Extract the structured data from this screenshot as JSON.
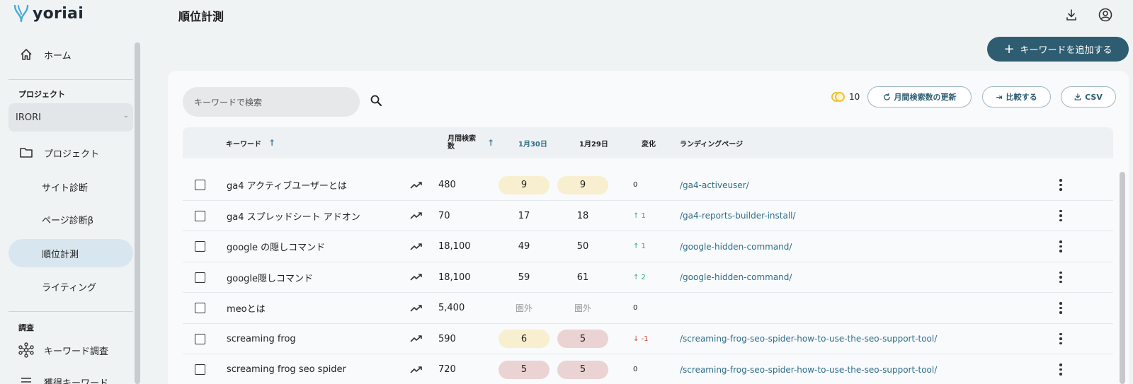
{
  "app": {
    "name": "yoriai"
  },
  "page": {
    "title": "順位計測"
  },
  "sidebar": {
    "home": "ホーム",
    "project_section": "プロジェクト",
    "project_selected": "IRORI",
    "project_item": "プロジェクト",
    "site_diagnosis": "サイト診断",
    "page_diagnosis": "ページ診断β",
    "rank_tracking": "順位計測",
    "writing": "ライティング",
    "research_section": "調査",
    "keyword_research": "キーワード調査",
    "acquired_keywords": "獲得キーワード"
  },
  "toolbar": {
    "add_keyword": "キーワードを追加する",
    "search_placeholder": "キーワードで検索",
    "credits": "10",
    "update_volume": "月間検索数の更新",
    "compare": "比較する",
    "csv": "CSV"
  },
  "table": {
    "headers": {
      "keyword": "キーワード",
      "volume": "月間検索数",
      "date1": "1月30日",
      "date2": "1月29日",
      "change": "変化",
      "landing": "ランディングページ"
    },
    "rows": [
      {
        "keyword": "ga4 アクティブユーザーとは",
        "volume": "480",
        "r1": "9",
        "r2": "9",
        "change": "0",
        "landing": "/ga4-activeuser/"
      },
      {
        "keyword": "ga4 スプレッドシート アドオン",
        "volume": "70",
        "r1": "17",
        "r2": "18",
        "change": "↑ 1",
        "landing": "/ga4-reports-builder-install/"
      },
      {
        "keyword": "google の隠しコマンド",
        "volume": "18,100",
        "r1": "49",
        "r2": "50",
        "change": "↑ 1",
        "landing": "/google-hidden-command/"
      },
      {
        "keyword": "google隠しコマンド",
        "volume": "18,100",
        "r1": "59",
        "r2": "61",
        "change": "↑ 2",
        "landing": "/google-hidden-command/"
      },
      {
        "keyword": "meoとは",
        "volume": "5,400",
        "r1": "圏外",
        "r2": "圏外",
        "change": "0",
        "landing": ""
      },
      {
        "keyword": "screaming frog",
        "volume": "590",
        "r1": "6",
        "r2": "5",
        "change": "↓ -1",
        "landing": "/screaming-frog-seo-spider-how-to-use-the-seo-support-tool/"
      },
      {
        "keyword": "screaming frog seo spider",
        "volume": "720",
        "r1": "5",
        "r2": "5",
        "change": "0",
        "landing": "/screaming-frog-seo-spider-how-to-use-the-seo-support-tool/"
      }
    ]
  },
  "colors": {
    "primary": "#2e5d72",
    "rank_yellow": "#f8efd0",
    "rank_red": "#ebd3d3",
    "change_up": "#3aa86b",
    "change_down": "#d04545",
    "link": "#2e6d8a"
  }
}
